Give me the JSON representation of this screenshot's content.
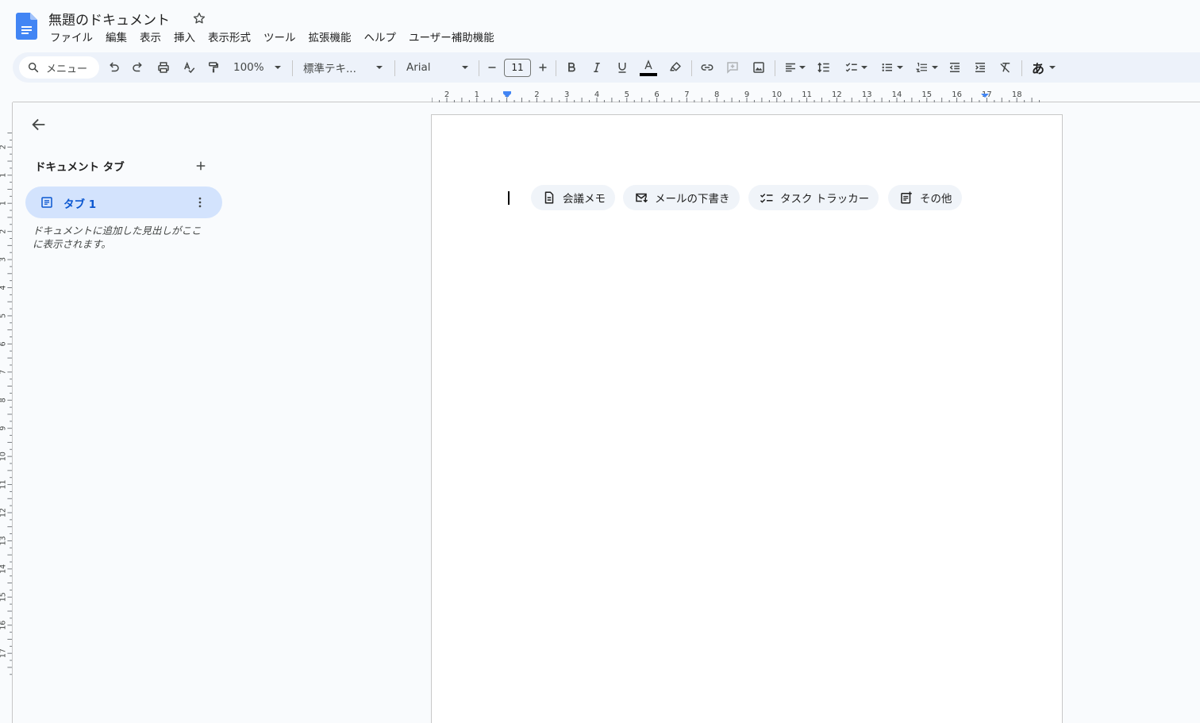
{
  "app": {
    "title": "無題のドキュメント"
  },
  "menubar": {
    "items": [
      "ファイル",
      "編集",
      "表示",
      "挿入",
      "表示形式",
      "ツール",
      "拡張機能",
      "ヘルプ",
      "ユーザー補助機能"
    ]
  },
  "toolbar": {
    "search_label": "メニュー",
    "zoom": "100%",
    "style": "標準テキ...",
    "font": "Arial",
    "font_size": "11",
    "input_mode": "あ",
    "text_color": "#000000"
  },
  "ruler": {
    "horizontal_labels": [
      "2",
      "1",
      "1",
      "2",
      "3",
      "4",
      "5",
      "6",
      "7",
      "8",
      "9",
      "10",
      "11",
      "12",
      "13",
      "14",
      "15",
      "16",
      "17",
      "18"
    ],
    "vertical_labels": [
      "2",
      "1",
      "1",
      "2",
      "3",
      "4",
      "5",
      "6",
      "7",
      "8",
      "9",
      "10",
      "11",
      "12",
      "13",
      "14",
      "15",
      "16",
      "17"
    ]
  },
  "sidebar": {
    "heading": "ドキュメント タブ",
    "tabs": [
      {
        "label": "タブ 1"
      }
    ],
    "hint": "ドキュメントに追加した見出しがここに表示されます。"
  },
  "chips": [
    {
      "label": "会議メモ",
      "icon": "document-icon"
    },
    {
      "label": "メールの下書き",
      "icon": "mail-draft-icon"
    },
    {
      "label": "タスク トラッカー",
      "icon": "checklist-icon"
    },
    {
      "label": "その他",
      "icon": "more-templates-icon"
    }
  ],
  "colors": {
    "accent": "#0b57d0",
    "toolbar_bg": "#edf2fa",
    "selected_tab_bg": "#d3e3fd",
    "page_bg": "#f9fbfd"
  }
}
